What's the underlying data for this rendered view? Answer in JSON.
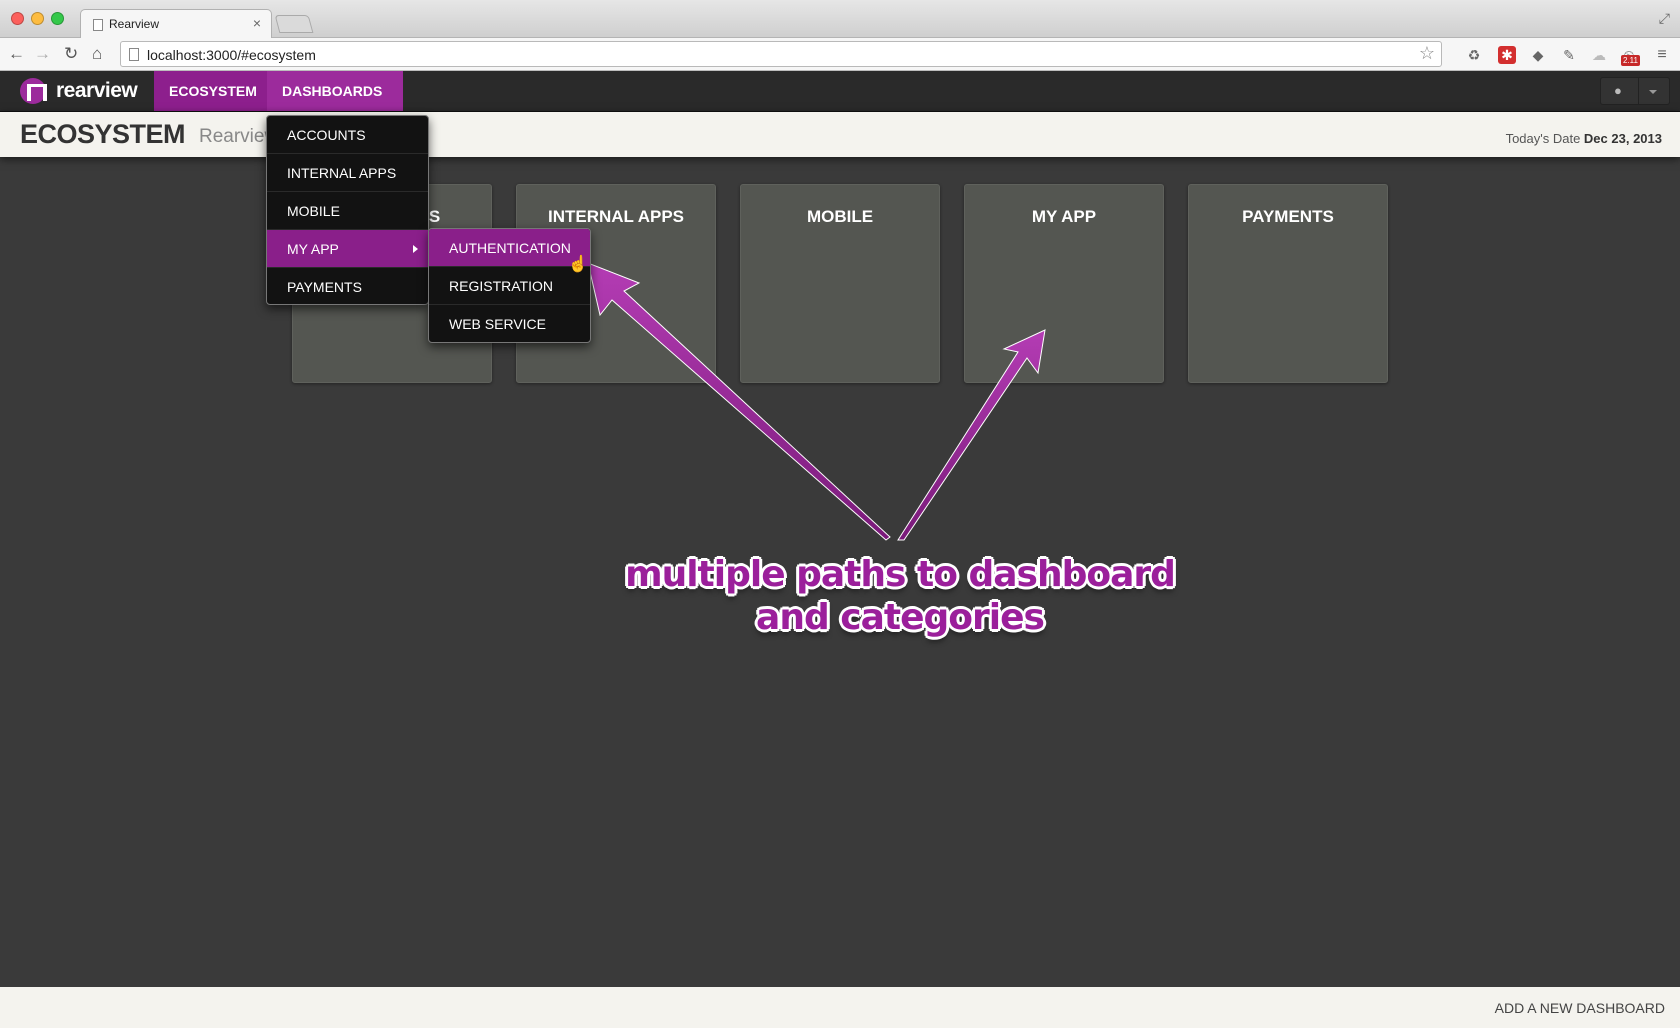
{
  "browser": {
    "tab_title": "Rearview",
    "tab_close": "×",
    "url": "localhost:3000/#ecosystem",
    "ext_badge": "2.11"
  },
  "icons": {
    "back": "←",
    "forward": "→",
    "reload": "↻",
    "home": "⌂",
    "star": "☆",
    "recycle": "♻",
    "lastpass": "✱",
    "evernote": "◆",
    "tool": "✎",
    "bulb": "☁",
    "badge": "⏲",
    "menu": "≡",
    "user": "●",
    "fullscreen": "⤢",
    "cursor": "☝"
  },
  "navbar": {
    "brand": "rearview",
    "links": [
      "ECOSYSTEM",
      "DASHBOARDS"
    ]
  },
  "header": {
    "title": "ECOSYSTEM",
    "subtitle": "Rearview Dashboards",
    "date_label": "Today's Date ",
    "date_value": "Dec 23, 2013"
  },
  "tiles": [
    "ACCOUNTS",
    "INTERNAL APPS",
    "MOBILE",
    "MY APP",
    "PAYMENTS"
  ],
  "dropdown": {
    "items": [
      "ACCOUNTS",
      "INTERNAL APPS",
      "MOBILE",
      "MY APP",
      "PAYMENTS"
    ],
    "active": "MY APP"
  },
  "submenu": {
    "items": [
      "AUTHENTICATION",
      "REGISTRATION",
      "WEB SERVICE"
    ],
    "active": "AUTHENTICATION"
  },
  "annotation": {
    "line1": "multiple paths to dashboard",
    "line2": "and categories"
  },
  "footer": {
    "add_dashboard": "ADD A NEW DASHBOARD"
  },
  "colors": {
    "accent": "#9c2b9c",
    "accent_dark": "#8a1f8a",
    "background": "#3a3a3a",
    "tile": "#545651"
  }
}
